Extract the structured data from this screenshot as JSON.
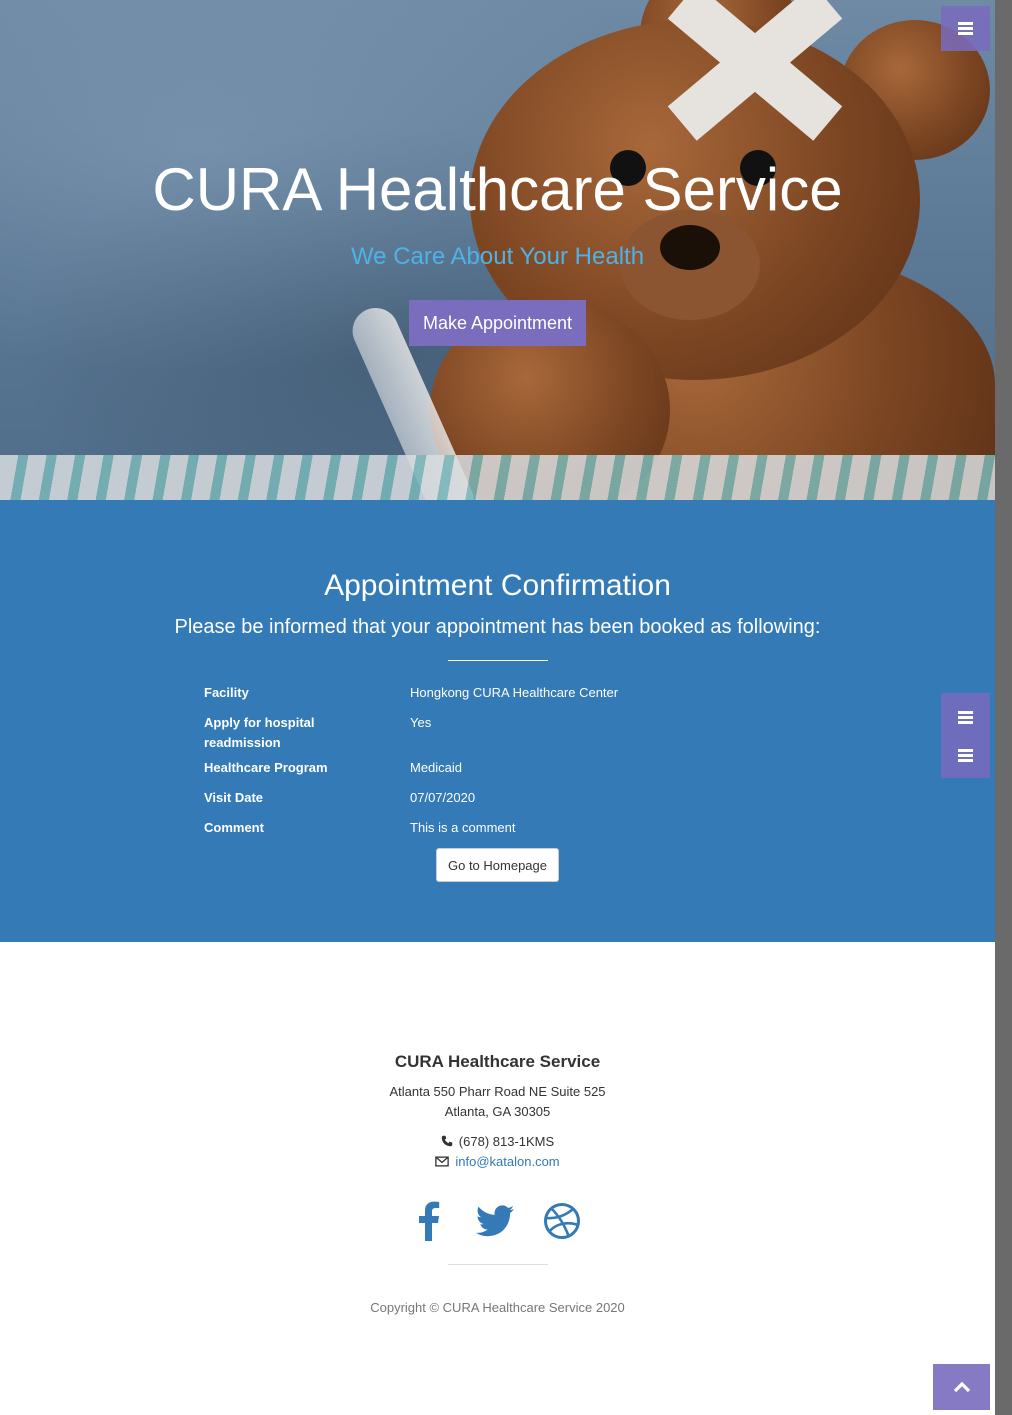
{
  "hero": {
    "title": "CURA Healthcare Service",
    "subtitle": "We Care About Your Health",
    "cta_label": "Make Appointment"
  },
  "confirmation": {
    "heading": "Appointment Confirmation",
    "lead": "Please be informed that your appointment has been booked as following:",
    "rows": [
      {
        "label": "Facility",
        "value": "Hongkong CURA Healthcare Center"
      },
      {
        "label": "Apply for hospital readmission",
        "value": "Yes"
      },
      {
        "label": "Healthcare Program",
        "value": "Medicaid"
      },
      {
        "label": "Visit Date",
        "value": "07/07/2020"
      },
      {
        "label": "Comment",
        "value": "This is a comment"
      }
    ],
    "home_button": "Go to Homepage"
  },
  "footer": {
    "title": "CURA Healthcare Service",
    "address_line1": "Atlanta 550 Pharr Road NE Suite 525",
    "address_line2": "Atlanta, GA 30305",
    "phone": "(678) 813-1KMS",
    "email": "info@katalon.com",
    "social": [
      "facebook-icon",
      "twitter-icon",
      "dribbble-icon"
    ],
    "copyright": "Copyright © CURA Healthcare Service 2020"
  },
  "colors": {
    "accent": "#7a6dbd",
    "section_blue": "#337ab7",
    "subtitle_blue": "#4fb2e6"
  }
}
